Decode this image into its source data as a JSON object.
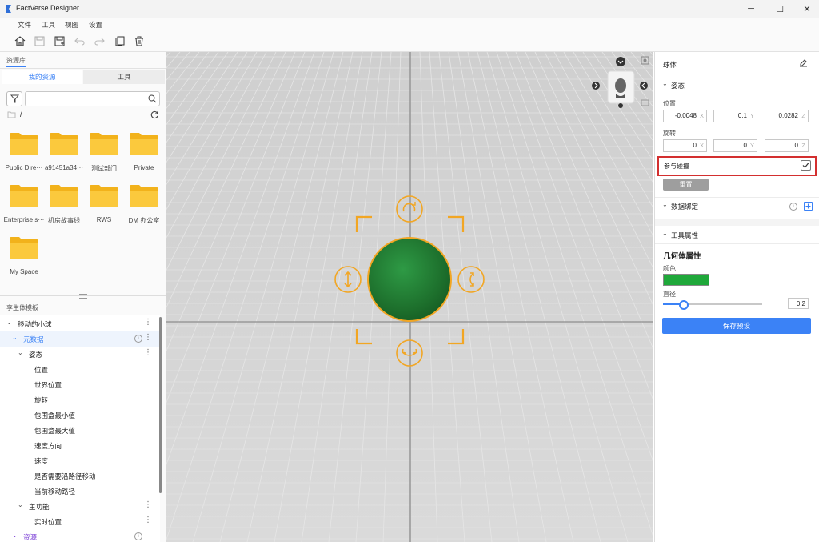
{
  "window": {
    "title": "FactVerse Designer",
    "minimize": "─",
    "maximize": "☐",
    "close": "✕"
  },
  "menu": [
    "文件",
    "工具",
    "视图",
    "设置"
  ],
  "left": {
    "panel_title": "资源库",
    "tabs": [
      "我的资源",
      "工具"
    ],
    "path": "/",
    "folders": [
      {
        "label": "Public Dire···"
      },
      {
        "label": "a91451a34···"
      },
      {
        "label": "测试部门"
      },
      {
        "label": "Private"
      },
      {
        "label": "Enterprise s···"
      },
      {
        "label": "机房故事线"
      },
      {
        "label": "RWS"
      },
      {
        "label": "DM 办公室"
      },
      {
        "label": "My Space"
      }
    ],
    "template_title": "孪生体模板",
    "tree": {
      "root": "移动的小球",
      "meta": "元数据",
      "pose": "姿态",
      "pose_items": [
        "位置",
        "世界位置",
        "旋转",
        "包围盒最小值",
        "包围盒最大值",
        "速度方向",
        "速度",
        "是否需要沿路径移动",
        "当前移动路径"
      ],
      "main": "主功能",
      "main_items": [
        "实时位置"
      ],
      "resource": "资源"
    }
  },
  "right": {
    "object_name": "球体",
    "pose_section": "姿态",
    "position_label": "位置",
    "position": {
      "x": "-0.0048",
      "y": "0.1",
      "z": "0.0282"
    },
    "rotation_label": "旋转",
    "rotation": {
      "x": "0",
      "y": "0",
      "z": "0"
    },
    "axis": {
      "x": "X",
      "y": "Y",
      "z": "Z"
    },
    "collision_label": "参与碰撞",
    "collision_checked": true,
    "reset_button": "重置",
    "data_binding_section": "数据绑定",
    "tool_props_section": "工具属性",
    "geometry_title": "几何体属性",
    "color_label": "颜色",
    "color_value": "#1fa83a",
    "diameter_label": "直径",
    "diameter_value": "0.2",
    "diameter_fraction": 0.2,
    "save_button": "保存预设"
  },
  "colors": {
    "accent": "#3b82f6",
    "handle": "#f2a623",
    "sphere": "#1f7a2e",
    "highlight": "#d32f2f"
  }
}
